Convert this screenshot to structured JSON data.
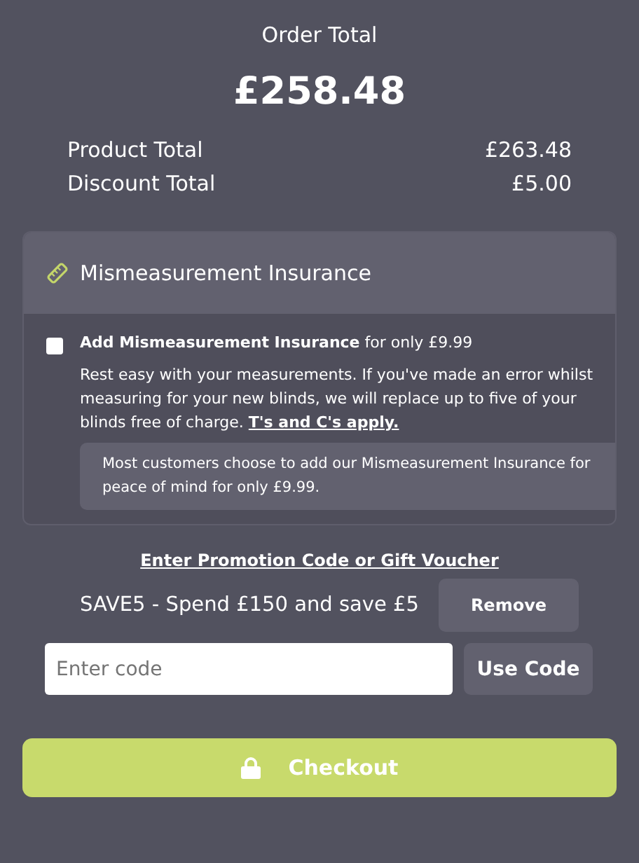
{
  "summary": {
    "title": "Order Total",
    "total": "£258.48",
    "rows": [
      {
        "label": "Product Total",
        "value": "£263.48"
      },
      {
        "label": "Discount Total",
        "value": "£5.00"
      }
    ]
  },
  "insurance": {
    "title": "Mismeasurement Insurance",
    "checked": false,
    "option": "**Add Mismeasurement Insurance** for only £9.99",
    "description": "Rest easy with your measurements. If you've made an error whilst measuring for your new blinds, we will replace up to five of your blinds free of charge.",
    "terms_link": "T's and C's apply.",
    "note": "Most customers choose to add our Mismeasurement Insurance for peace of mind for only £9.99."
  },
  "promo": {
    "link": "Enter Promotion Code or Gift Voucher",
    "applied": "SAVE5 - Spend £150 and save £5",
    "remove_button": "Remove",
    "placeholder": "Enter code",
    "use_button": "Use Code"
  },
  "checkout_button": "Checkout"
}
